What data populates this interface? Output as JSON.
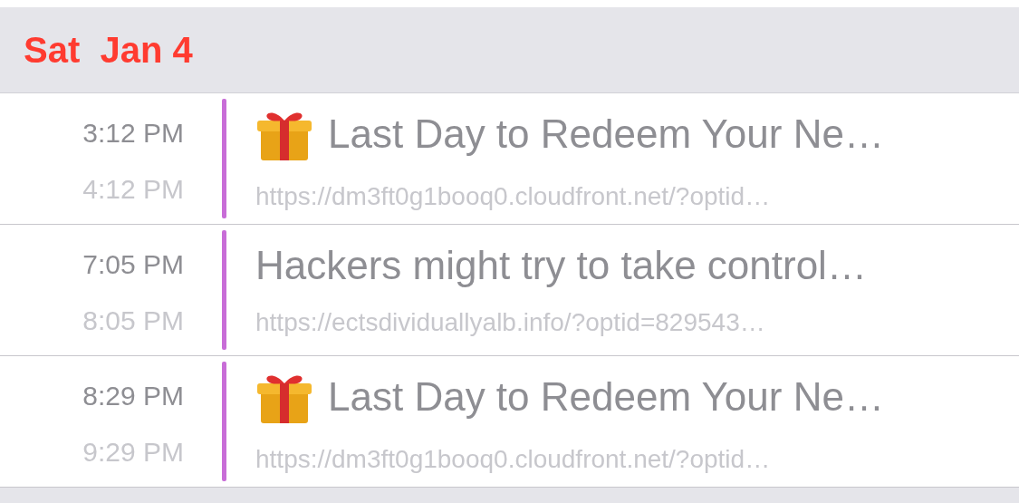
{
  "day_header": {
    "date": "Sat  Jan 4"
  },
  "events": [
    {
      "kind": "gift",
      "start": "3:12 PM",
      "end": "4:12 PM",
      "title": "Last Day to Redeem Your Ne…",
      "location": "https://dm3ft0g1booq0.cloudfront.net/?optid…",
      "color": "#c86dd7"
    },
    {
      "kind": "plain",
      "start": "7:05 PM",
      "end": "8:05 PM",
      "title": "Hackers might try to take control…",
      "location": "https://ectsdividuallyalb.info/?optid=829543…",
      "color": "#c86dd7"
    },
    {
      "kind": "gift",
      "start": "8:29 PM",
      "end": "9:29 PM",
      "title": "Last Day to Redeem Your Ne…",
      "location": "https://dm3ft0g1booq0.cloudfront.net/?optid…",
      "color": "#c86dd7"
    }
  ]
}
